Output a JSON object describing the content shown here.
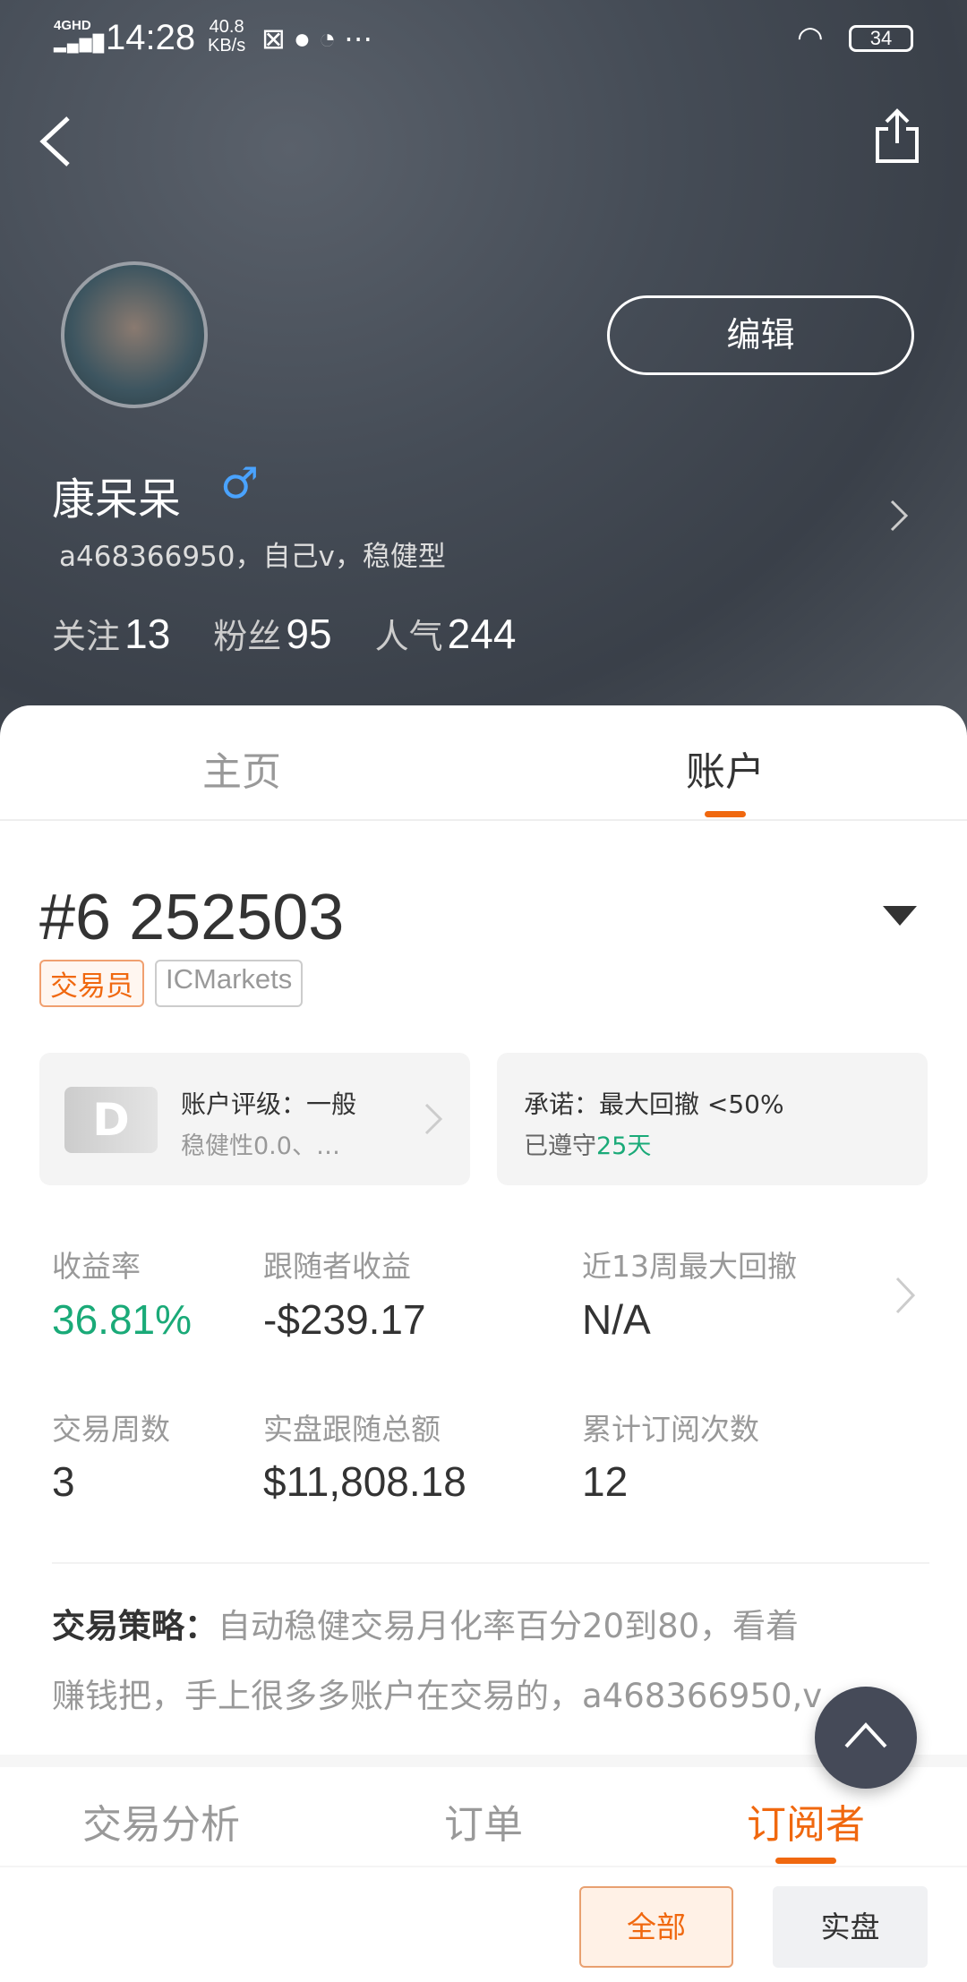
{
  "status_bar": {
    "network": "4GHD",
    "time": "14:28",
    "speed": "40.8",
    "speed_unit": "KB/s",
    "battery": "34"
  },
  "profile": {
    "name": "康呆呆",
    "gender": "♂",
    "bio": "a468366950，自己v，稳健型",
    "edit_label": "编辑",
    "stats": [
      {
        "label": "关注",
        "value": "13"
      },
      {
        "label": "粉丝",
        "value": "95"
      },
      {
        "label": "人气",
        "value": "244"
      }
    ]
  },
  "tabs": [
    {
      "label": "主页"
    },
    {
      "label": "账户"
    }
  ],
  "account": {
    "number": "#6 252503",
    "badges": [
      "交易员",
      "ICMarkets"
    ],
    "rating_card": {
      "grade": "D",
      "title": "账户评级：一般",
      "sub": "稳健性0.0、…"
    },
    "promise_card": {
      "title": "承诺：最大回撤 <50%",
      "sub_prefix": "已遵守",
      "sub_days": "25天"
    },
    "metrics": [
      {
        "label": "收益率",
        "value": "36.81%"
      },
      {
        "label": "跟随者收益",
        "value": "-$239.17"
      },
      {
        "label": "近13周最大回撤",
        "value": "N/A"
      },
      {
        "label": "交易周数",
        "value": "3"
      },
      {
        "label": "实盘跟随总额",
        "value": "$11,808.18"
      },
      {
        "label": "累计订阅次数",
        "value": "12"
      }
    ],
    "strategy_label": "交易策略：",
    "strategy_line1": "自动稳健交易月化率百分20到80，看着",
    "strategy_line2": "赚钱把，手上很多多账户在交易的，a468366950,v"
  },
  "sub_tabs": [
    {
      "label": "交易分析"
    },
    {
      "label": "订单"
    },
    {
      "label": "订阅者"
    }
  ],
  "filters": [
    {
      "label": "全部"
    },
    {
      "label": "实盘"
    }
  ],
  "colors": {
    "accent": "#f0680f",
    "green": "#1aaa78",
    "fab": "#454a58"
  }
}
